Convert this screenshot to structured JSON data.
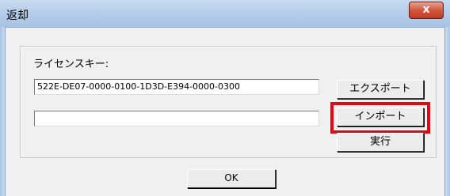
{
  "window": {
    "title": "返却",
    "close_glyph": "x"
  },
  "license": {
    "label": "ライセンスキー:",
    "key_value": "522E-DE07-0000-0100-1D3D-E394-0000-0300",
    "import_value": ""
  },
  "buttons": {
    "export": "エクスポート",
    "import": "インポート",
    "execute": "実行",
    "ok": "OK"
  },
  "colors": {
    "highlight": "#e30613",
    "close": "#c23a22"
  }
}
